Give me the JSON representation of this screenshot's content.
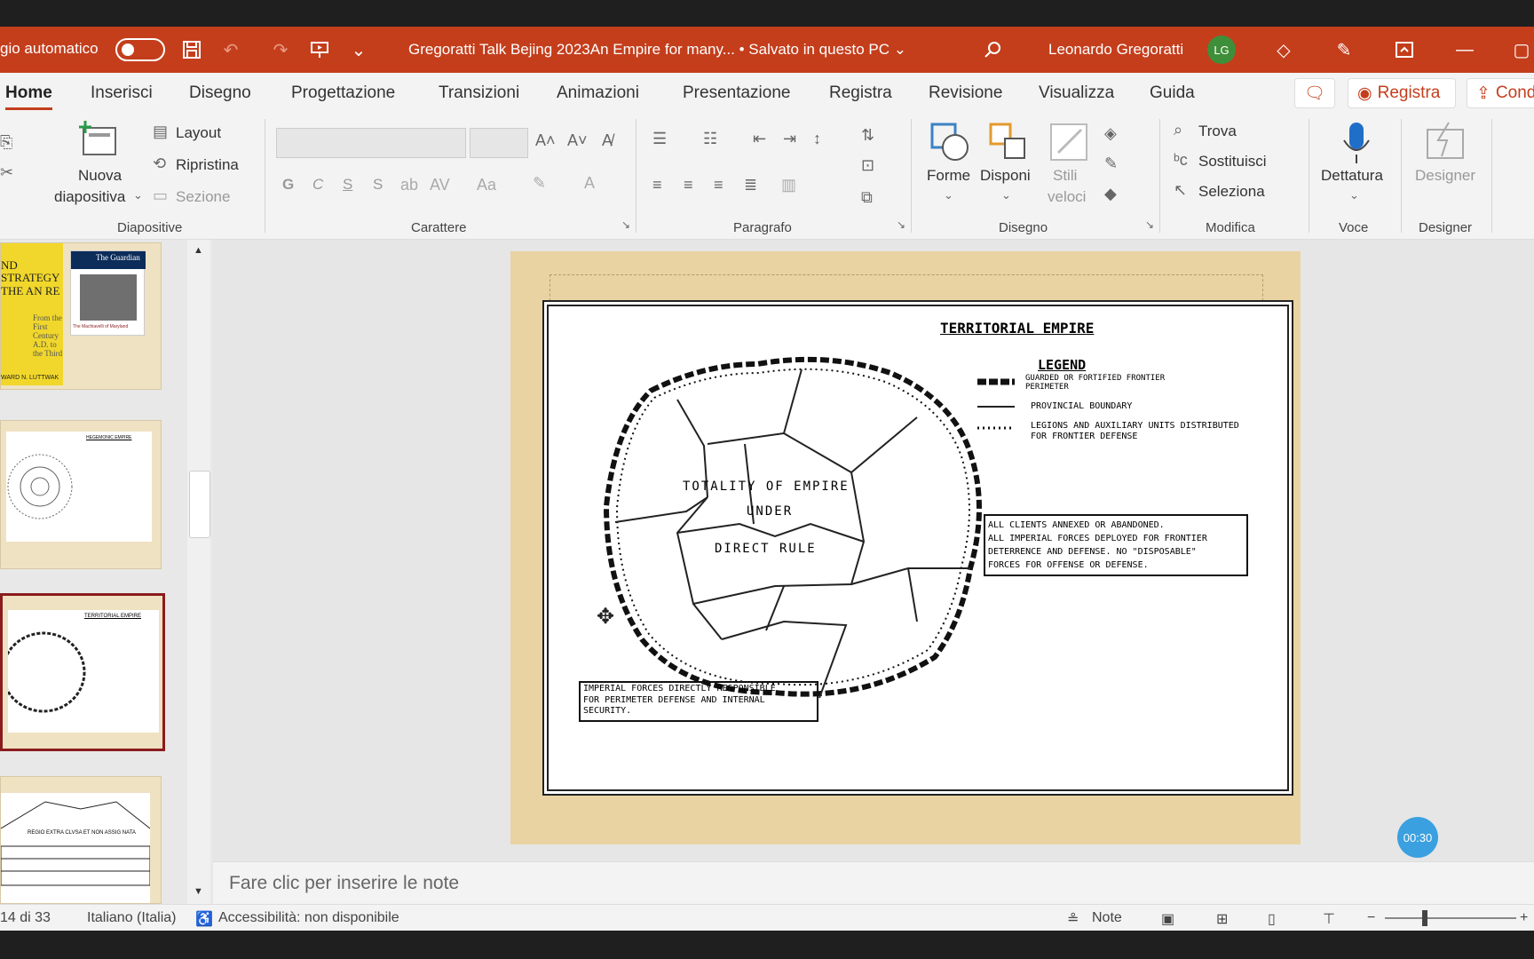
{
  "titlebar": {
    "autosave_label": "gio automatico",
    "doc_title": "Gregoratti Talk Bejing 2023An Empire for many...  •  Salvato in questo PC ⌄",
    "user_name": "Leonardo Gregoratti",
    "avatar_initials": "LG",
    "accent_color": "#c43e1c"
  },
  "tabs": [
    "Home",
    "Inserisci",
    "Disegno",
    "Progettazione",
    "Transizioni",
    "Animazioni",
    "Presentazione",
    "Registra",
    "Revisione",
    "Visualizza",
    "Guida"
  ],
  "tab_actions": {
    "record": "Registra",
    "share": "Cond"
  },
  "ribbon": {
    "diapositive": {
      "new_slide_line1": "Nuova",
      "new_slide_line2": "diapositiva",
      "layout": "Layout",
      "reset": "Ripristina",
      "section": "Sezione",
      "group_label": "Diapositive"
    },
    "carattere": {
      "group_label": "Carattere",
      "bold": "G",
      "italic": "C",
      "underline": "S",
      "shadow": "S"
    },
    "paragrafo": {
      "group_label": "Paragrafo"
    },
    "disegno": {
      "shapes": "Forme",
      "arrange": "Disponi",
      "quick_styles_line1": "Stili",
      "quick_styles_line2": "veloci",
      "group_label": "Disegno"
    },
    "modifica": {
      "find": "Trova",
      "replace": "Sostituisci",
      "select": "Seleziona",
      "group_label": "Modifica"
    },
    "voce": {
      "dictate": "Dettatura",
      "group_label": "Voce"
    },
    "designer": {
      "designer": "Designer",
      "group_label": "Designer"
    }
  },
  "thumbnails": {
    "slide1_text": "The Guardian",
    "slide1_caption": "The Machiavelli of Maryland",
    "slide1_book": "ND STRATEGY THE AN RE",
    "slide1_author": "WARD N. LUTTWAK",
    "slide1_sub": "From the First Century A.D. to the Third",
    "slide2_title": "HEGEMONIC EMPIRE",
    "slide3_title": "TERRITORIAL EMPIRE",
    "slide4_text": "REGIO EXTRA CLVSA ET NON ASSIG NATA"
  },
  "slide": {
    "title": "TERRITORIAL EMPIRE",
    "legend_title": "LEGEND",
    "legend": [
      "GUARDED OR FORTIFIED FRONTIER PERIMETER",
      "PROVINCIAL BOUNDARY",
      "LEGIONS AND AUXILIARY UNITS DISTRIBUTED FOR FRONTIER DEFENSE"
    ],
    "center_line1": "TOTALITY OF EMPIRE",
    "center_line2": "UNDER",
    "center_line3": "DIRECT RULE",
    "box_right": [
      "ALL CLIENTS ANNEXED OR ABANDONED.",
      "ALL IMPERIAL FORCES DEPLOYED FOR FRONTIER",
      "DETERRENCE AND DEFENSE. NO \"DISPOSABLE\"",
      "FORCES FOR OFFENSE OR DEFENSE."
    ],
    "box_bottom": [
      "IMPERIAL FORCES DIRECTLY RESPONSIBLE",
      "FOR PERIMETER DEFENSE AND INTERNAL",
      "SECURITY."
    ]
  },
  "timer": "00:30",
  "notes_placeholder": "Fare clic per inserire le note",
  "status": {
    "slide_count": "14 di 33",
    "language": "Italiano (Italia)",
    "accessibility": "Accessibilità: non disponibile",
    "notes": "Note"
  }
}
